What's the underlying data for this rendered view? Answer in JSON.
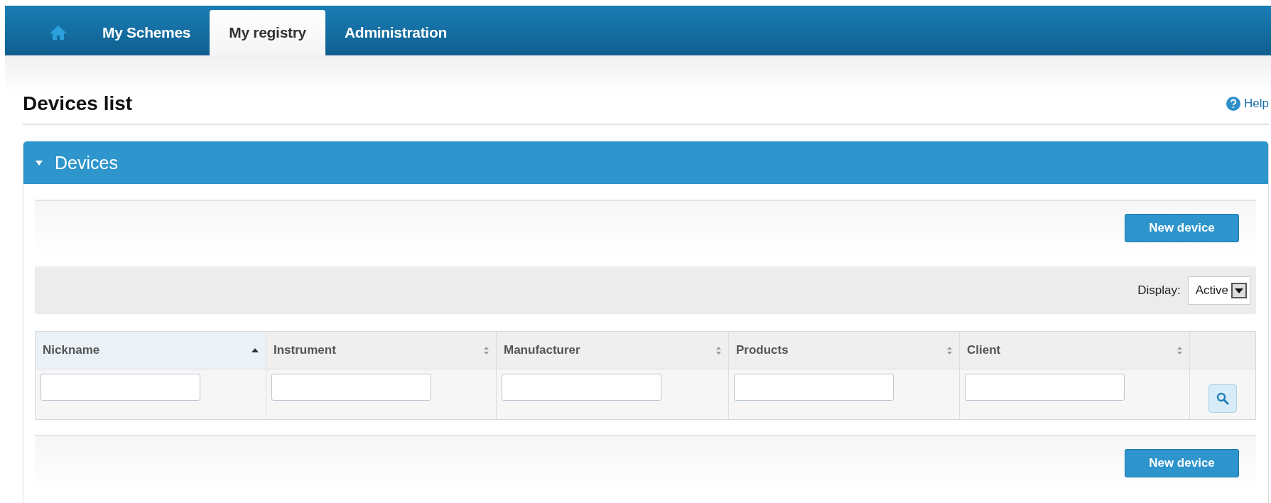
{
  "nav": {
    "home": {
      "selected": false
    },
    "tabs": [
      {
        "label": "My Schemes",
        "selected": false
      },
      {
        "label": "My registry",
        "selected": true
      },
      {
        "label": "Administration",
        "selected": false
      }
    ]
  },
  "page_title": "Devices list",
  "help_link": "Help",
  "panel": {
    "title": "Devices",
    "expanded": true
  },
  "top_toolbar": {
    "button": "New device"
  },
  "display": {
    "label": "Display:",
    "value": "Active"
  },
  "table": {
    "columns": [
      {
        "label": "Nickname",
        "sorted": true
      },
      {
        "label": "Instrument",
        "sorted": false
      },
      {
        "label": "Manufacturer",
        "sorted": false
      },
      {
        "label": "Products",
        "sorted": false
      },
      {
        "label": "Client",
        "sorted": false
      }
    ]
  },
  "bottom_toolbar": {
    "button": "New device"
  }
}
